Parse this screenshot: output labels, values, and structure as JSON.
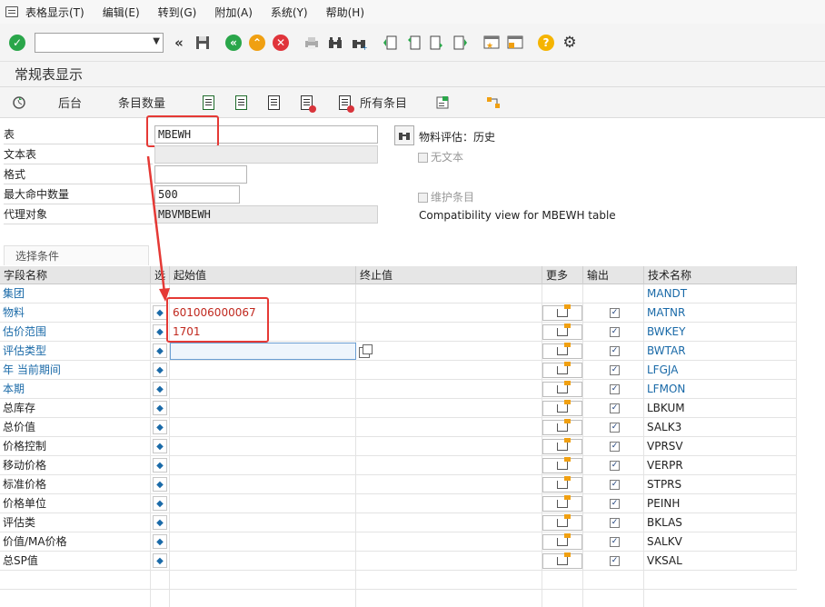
{
  "menu": {
    "items": [
      "表格显示(T)",
      "编辑(E)",
      "转到(G)",
      "附加(A)",
      "系统(Y)",
      "帮助(H)"
    ]
  },
  "toolbar": {
    "command_value": "",
    "icons": [
      "check-icon",
      "back-double-icon",
      "save-icon",
      "back-icon",
      "exit-icon",
      "cancel-icon",
      "print-icon",
      "find-icon",
      "find-next-icon",
      "first-page-icon",
      "prev-page-icon",
      "next-page-icon",
      "last-page-icon",
      "new-session-icon",
      "shortcut-icon",
      "help-icon",
      "settings-icon"
    ]
  },
  "title": "常规表显示",
  "app_toolbar": {
    "backend_label": "后台",
    "count_label": "条目数量",
    "all_entries_label": "所有条目"
  },
  "form": {
    "table_label": "表",
    "table_value": "MBEWH",
    "text_table_label": "文本表",
    "text_table_value": "",
    "format_label": "格式",
    "format_value": "",
    "max_hits_label": "最大命中数量",
    "max_hits_value": "500",
    "proxy_label": "代理对象",
    "proxy_value": "MBVMBEWH",
    "table_desc": "物料评估：历史",
    "no_text_label": "无文本",
    "maintain_label": "维护条目",
    "compat_text": "Compatibility view for MBEWH table"
  },
  "selection": {
    "tab_label": "选择条件",
    "headers": {
      "field": "字段名称",
      "opt": "选",
      "from": "起始值",
      "to": "终止值",
      "more": "更多",
      "output": "输出",
      "tech": "技术名称"
    },
    "rows": [
      {
        "name": "集团",
        "from": "",
        "tech": "MANDT",
        "key": true,
        "output": false,
        "more": false,
        "opt": false
      },
      {
        "name": "物料",
        "from": "601006000067",
        "tech": "MATNR",
        "key": true,
        "output": true,
        "more": true,
        "opt": true
      },
      {
        "name": "估价范围",
        "from": "1701",
        "tech": "BWKEY",
        "key": true,
        "output": true,
        "more": true,
        "opt": true
      },
      {
        "name": "评估类型",
        "from": "",
        "tech": "BWTAR",
        "key": true,
        "output": true,
        "more": true,
        "opt": true
      },
      {
        "name": "年 当前期间",
        "from": "",
        "tech": "LFGJA",
        "key": true,
        "output": true,
        "more": true,
        "opt": true
      },
      {
        "name": "本期",
        "from": "",
        "tech": "LFMON",
        "key": true,
        "output": true,
        "more": true,
        "opt": true
      },
      {
        "name": "总库存",
        "from": "",
        "tech": "LBKUM",
        "key": false,
        "output": true,
        "more": true,
        "opt": true
      },
      {
        "name": "总价值",
        "from": "",
        "tech": "SALK3",
        "key": false,
        "output": true,
        "more": true,
        "opt": true
      },
      {
        "name": "价格控制",
        "from": "",
        "tech": "VPRSV",
        "key": false,
        "output": true,
        "more": true,
        "opt": true
      },
      {
        "name": "移动价格",
        "from": "",
        "tech": "VERPR",
        "key": false,
        "output": true,
        "more": true,
        "opt": true
      },
      {
        "name": "标准价格",
        "from": "",
        "tech": "STPRS",
        "key": false,
        "output": true,
        "more": true,
        "opt": true
      },
      {
        "name": "价格单位",
        "from": "",
        "tech": "PEINH",
        "key": false,
        "output": true,
        "more": true,
        "opt": true
      },
      {
        "name": "评估类",
        "from": "",
        "tech": "BKLAS",
        "key": false,
        "output": true,
        "more": true,
        "opt": true
      },
      {
        "name": "价值/MA价格",
        "from": "",
        "tech": "SALKV",
        "key": false,
        "output": true,
        "more": true,
        "opt": true
      },
      {
        "name": "总SP值",
        "from": "",
        "tech": "VKSAL",
        "key": false,
        "output": true,
        "more": true,
        "opt": true
      }
    ]
  },
  "colors": {
    "key_field": "#1a6aa8",
    "highlight": "#e53935",
    "entered_value": "#c0281e"
  }
}
